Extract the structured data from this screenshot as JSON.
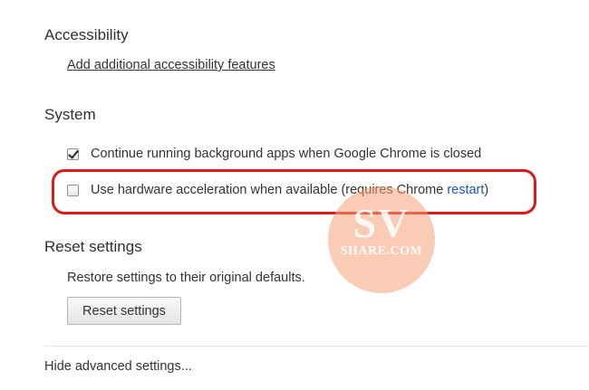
{
  "accessibility": {
    "heading": "Accessibility",
    "link": "Add additional accessibility features"
  },
  "system": {
    "heading": "System",
    "background_apps": {
      "label": "Continue running background apps when Google Chrome is closed",
      "checked": true
    },
    "hardware_acceleration": {
      "label": "Use hardware acceleration when available (requires Chrome ",
      "link": "restart",
      "suffix": ")",
      "checked": false
    }
  },
  "reset": {
    "heading": "Reset settings",
    "description": "Restore settings to their original defaults.",
    "button": "Reset settings"
  },
  "footer": {
    "hide_advanced": "Hide advanced settings..."
  },
  "watermark": {
    "top": "SV",
    "bottom": "SHARE.COM"
  },
  "colors": {
    "link": "#1a58b8",
    "highlight": "#e01818",
    "watermark": "#f6a078"
  }
}
